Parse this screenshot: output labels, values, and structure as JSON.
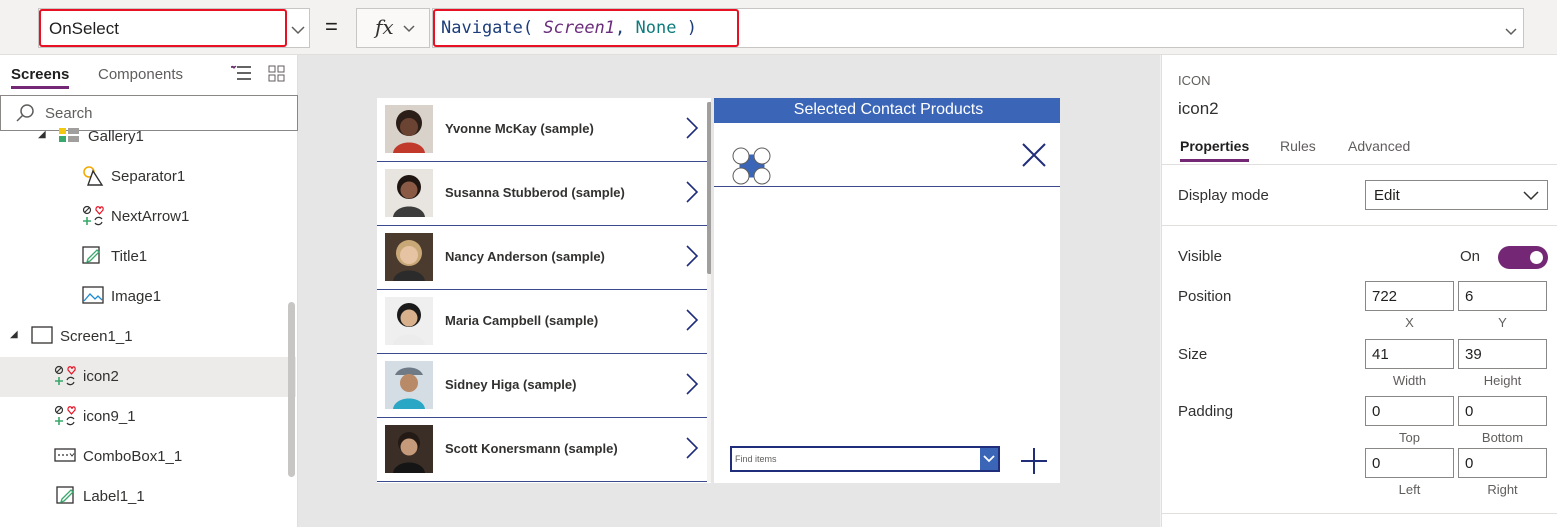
{
  "formula_bar": {
    "property": "OnSelect",
    "equals": "=",
    "fx": "fx",
    "formula_fn": "Navigate(",
    "formula_arg1": "Screen1",
    "formula_sep": ",",
    "formula_arg2": "None",
    "formula_close": ")"
  },
  "left_pane": {
    "tabs": [
      "Screens",
      "Components"
    ],
    "search_placeholder": "Search",
    "tree": [
      {
        "label": "Gallery1",
        "icon": "gallery-icon"
      },
      {
        "label": "Separator1",
        "icon": "shapes-icon"
      },
      {
        "label": "NextArrow1",
        "icon": "icons-icon"
      },
      {
        "label": "Title1",
        "icon": "edit-label-icon"
      },
      {
        "label": "Image1",
        "icon": "image-icon"
      },
      {
        "label": "Screen1_1",
        "icon": "screen-icon"
      },
      {
        "label": "icon2",
        "icon": "icons-icon"
      },
      {
        "label": "icon9_1",
        "icon": "icons-icon"
      },
      {
        "label": "ComboBox1_1",
        "icon": "combobox-icon"
      },
      {
        "label": "Label1_1",
        "icon": "edit-label-icon"
      }
    ]
  },
  "canvas": {
    "contacts": [
      "Yvonne McKay (sample)",
      "Susanna Stubberod (sample)",
      "Nancy Anderson (sample)",
      "Maria Campbell (sample)",
      "Sidney Higa (sample)",
      "Scott Konersmann (sample)"
    ],
    "detail_title": "Selected Contact Products",
    "combo_placeholder": "Find items"
  },
  "right_pane": {
    "type": "ICON",
    "name": "icon2",
    "tabs": [
      "Properties",
      "Rules",
      "Advanced"
    ],
    "display_mode_label": "Display mode",
    "display_mode_value": "Edit",
    "visible_label": "Visible",
    "visible_value": "On",
    "position_label": "Position",
    "position_x": "722",
    "position_y": "6",
    "x_caption": "X",
    "y_caption": "Y",
    "size_label": "Size",
    "size_width": "41",
    "size_height": "39",
    "width_caption": "Width",
    "height_caption": "Height",
    "padding_label": "Padding",
    "padding_top": "0",
    "padding_bottom": "0",
    "padding_left": "0",
    "padding_right": "0",
    "top_caption": "Top",
    "bottom_caption": "Bottom",
    "left_caption": "Left",
    "right_caption": "Right"
  },
  "colors": {
    "accent": "#742774",
    "header_blue": "#3b66b8",
    "highlight_red": "#e81123"
  }
}
